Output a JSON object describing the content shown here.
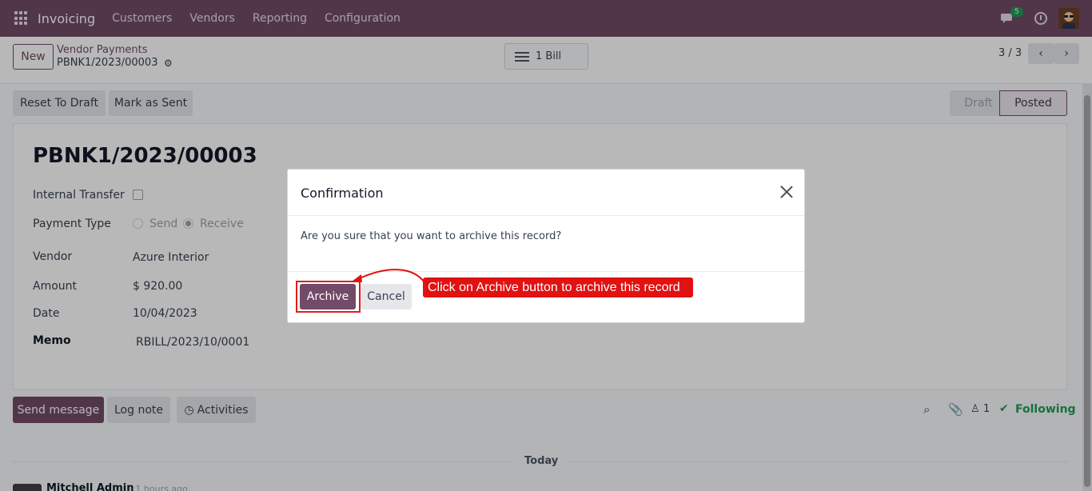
{
  "navbar": {
    "app_name": "Invoicing",
    "menu": [
      "Customers",
      "Vendors",
      "Reporting",
      "Configuration"
    ],
    "chat_count": "5"
  },
  "control": {
    "new_label": "New",
    "breadcrumb_parent": "Vendor Payments",
    "breadcrumb_current": "PBNK1/2023/00003",
    "smart_button": "1 Bill",
    "pager": "3 / 3"
  },
  "statusbar": {
    "reset_label": "Reset To Draft",
    "mark_sent_label": "Mark as Sent",
    "stages": [
      "Draft",
      "Posted"
    ],
    "active_stage": "Posted"
  },
  "form": {
    "title": "PBNK1/2023/00003",
    "internal_transfer_label": "Internal Transfer",
    "payment_type_label": "Payment Type",
    "payment_type_send": "Send",
    "payment_type_receive": "Receive",
    "vendor_label": "Vendor",
    "vendor_value": "Azure Interior",
    "amount_label": "Amount",
    "amount_value": "$ 920.00",
    "date_label": "Date",
    "date_value": "10/04/2023",
    "memo_label": "Memo",
    "memo_value": "RBILL/2023/10/0001"
  },
  "chatter": {
    "send_message": "Send message",
    "log_note": "Log note",
    "activities": "Activities",
    "followers_count": "1",
    "following": "Following",
    "today": "Today",
    "author": "Mitchell Admin",
    "time": "- 1 hours ago"
  },
  "modal": {
    "title": "Confirmation",
    "body": "Are you sure that you want to archive this record?",
    "archive_label": "Archive",
    "cancel_label": "Cancel"
  },
  "annotation": {
    "callout": "Click on Archive button to archive this record"
  },
  "colors": {
    "brand": "#714b67",
    "annotation": "#e11212",
    "success": "#1f9d55"
  }
}
